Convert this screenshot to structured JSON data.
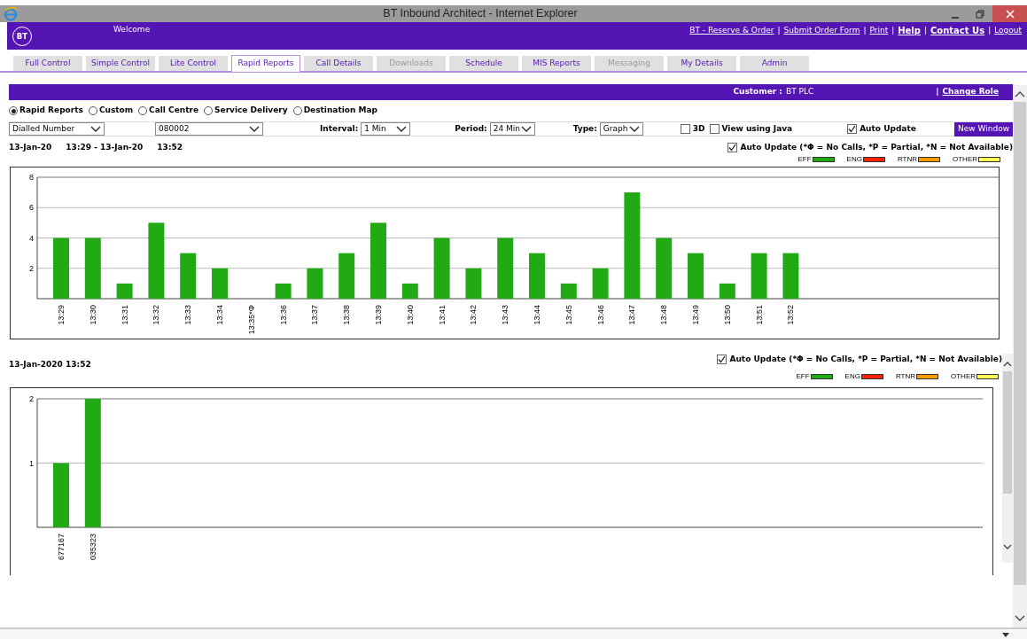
{
  "window": {
    "title": "BT Inbound Architect - Internet Explorer"
  },
  "header": {
    "logo": "BT",
    "welcome": "Welcome",
    "links": [
      {
        "label": "BT - Reserve & Order",
        "bold": false
      },
      {
        "label": "Submit Order Form",
        "bold": false,
        "separator": "|"
      },
      {
        "label": "Print",
        "bold": false,
        "separator": "|"
      },
      {
        "label": "Help",
        "bold": true,
        "separator": "|"
      },
      {
        "label": "Contact Us",
        "bold": true,
        "separator": "|"
      },
      {
        "label": "Logout",
        "bold": false,
        "separator": "|"
      }
    ]
  },
  "tabs": [
    {
      "label": "Full Control",
      "selected": false,
      "disabled": false
    },
    {
      "label": "Simple Control",
      "selected": false,
      "disabled": false
    },
    {
      "label": "Lite Control",
      "selected": false,
      "disabled": false
    },
    {
      "label": "Rapid Reports",
      "selected": true,
      "disabled": false
    },
    {
      "label": "Call Details",
      "selected": false,
      "disabled": false
    },
    {
      "label": "Downloads",
      "selected": false,
      "disabled": true
    },
    {
      "label": "Schedule",
      "selected": false,
      "disabled": false
    },
    {
      "label": "MIS Reports",
      "selected": false,
      "disabled": false
    },
    {
      "label": "Messaging",
      "selected": false,
      "disabled": true
    },
    {
      "label": "My Details",
      "selected": false,
      "disabled": false
    },
    {
      "label": "Admin",
      "selected": false,
      "disabled": false
    }
  ],
  "customer_bar": {
    "label": "Customer :",
    "value": "BT PLC",
    "separator": "|",
    "link": "Change Role"
  },
  "report_types": [
    {
      "label": "Rapid Reports",
      "selected": true
    },
    {
      "label": "Custom",
      "selected": false
    },
    {
      "label": "Call Centre",
      "selected": false
    },
    {
      "label": "Service Delivery",
      "selected": false
    },
    {
      "label": "Destination Map",
      "selected": false
    }
  ],
  "filters": {
    "measure": {
      "value": "Dialled Number"
    },
    "number": {
      "value": "080002"
    },
    "interval": {
      "label": "Interval:",
      "value": "1 Min"
    },
    "period": {
      "label": "Period:",
      "value": "24 Min"
    },
    "type": {
      "label": "Type:",
      "value": "Graph"
    },
    "options": [
      {
        "label": "3D",
        "checked": false
      },
      {
        "label": "View using Java",
        "checked": false
      },
      {
        "label": "Auto Update",
        "checked": true
      }
    ],
    "new_window": "New Window"
  },
  "sections": [
    {
      "date_parts": [
        "13-Jan-20",
        "13:29 - 13-Jan-20",
        "13:52"
      ],
      "auto_update": {
        "checked": true,
        "label": "Auto Update (*Φ = No Calls, *P = Partial, *N = Not Available)"
      },
      "legend": [
        {
          "label": "EFF",
          "color": "#22aa14"
        },
        {
          "label": "ENG",
          "color": "#ff2200"
        },
        {
          "label": "RTNR",
          "color": "#ff9900"
        },
        {
          "label": "OTHER",
          "color": "#ffff55"
        }
      ],
      "chart_data": {
        "type": "bar",
        "categories": [
          "13:29",
          "13:30",
          "13:31",
          "13:32",
          "13:33",
          "13:34",
          "13:35*Φ",
          "13:36",
          "13:37",
          "13:38",
          "13:39",
          "13:40",
          "13:41",
          "13:42",
          "13:43",
          "13:44",
          "13:45",
          "13:46",
          "13:47",
          "13:48",
          "13:49",
          "13:50",
          "13:51",
          "13:52"
        ],
        "series": [
          {
            "color": "#22aa14",
            "values": [
              4,
              4,
              1,
              5,
              3,
              2,
              0,
              1,
              2,
              3,
              5,
              1,
              4,
              2,
              4,
              3,
              1,
              2,
              7,
              4,
              3,
              1,
              3,
              3
            ]
          }
        ],
        "ylim": [
          0,
          8
        ],
        "yticks": [
          2,
          4,
          6,
          8
        ],
        "grid": true
      }
    },
    {
      "date_parts": [
        "13-Jan-2020 13:52"
      ],
      "auto_update": {
        "checked": true,
        "label": "Auto Update (*Φ = No Calls, *P = Partial, *N = Not Available)"
      },
      "legend": [
        {
          "label": "EFF",
          "color": "#22aa14"
        },
        {
          "label": "ENG",
          "color": "#ff2200"
        },
        {
          "label": "RTNR",
          "color": "#ff9900"
        },
        {
          "label": "OTHER",
          "color": "#ffff55"
        }
      ],
      "chart_data": {
        "type": "bar",
        "categories": [
          "677167",
          "035323"
        ],
        "series": [
          {
            "color": "#22aa14",
            "values": [
              1,
              2
            ]
          }
        ],
        "ylim": [
          0,
          2
        ],
        "yticks": [
          1,
          2
        ],
        "grid": true
      }
    }
  ]
}
